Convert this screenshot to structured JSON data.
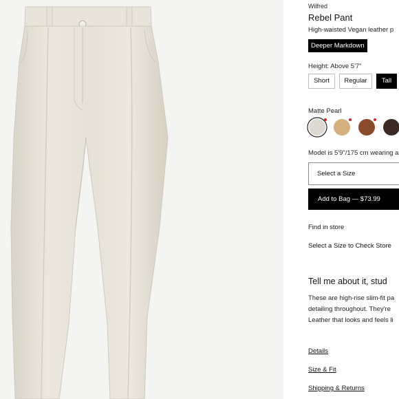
{
  "product": {
    "brand": "Wilfred",
    "name": "Rebel Pant",
    "subtitle": "High-waisted Vegan leather p",
    "promo_badge": "Deeper Markdown",
    "height_label": "Height: Above 5'7\"",
    "height_options": [
      {
        "label": "Short",
        "selected": false
      },
      {
        "label": "Regular",
        "selected": false
      },
      {
        "label": "Tall",
        "selected": true
      }
    ],
    "color_label": "Matte Pearl",
    "swatches": [
      {
        "name": "matte-pearl",
        "color": "#dedad2",
        "selected": true,
        "sale_dot": true
      },
      {
        "name": "tan",
        "color": "#d5b07f",
        "selected": false,
        "sale_dot": true
      },
      {
        "name": "brown",
        "color": "#8a4a2b",
        "selected": false,
        "sale_dot": true
      },
      {
        "name": "dark-brown",
        "color": "#3b2a24",
        "selected": false,
        "sale_dot": false
      }
    ],
    "model_note": "Model is 5'9\"/175 cm wearing a",
    "select_size_placeholder": "Select a Size",
    "add_to_bag_label": "Add to Bag — $73.99",
    "find_in_store": "Find in store",
    "check_store_prompt": "Select a Size to Check Store"
  },
  "about": {
    "heading": "Tell me about it, stud",
    "lines": [
      "These are high-rise slim-fit pa",
      "detailing throughout. They're",
      "Leather that looks and feels li"
    ]
  },
  "links": {
    "details": "Details",
    "size_fit": "Size & Fit",
    "shipping_returns": "Shipping & Returns"
  },
  "colors": {
    "accent": "#000000",
    "pant": "#e8e3d8",
    "photo_bg": "#f4f4f3",
    "sale_dot": "#d9242a"
  }
}
